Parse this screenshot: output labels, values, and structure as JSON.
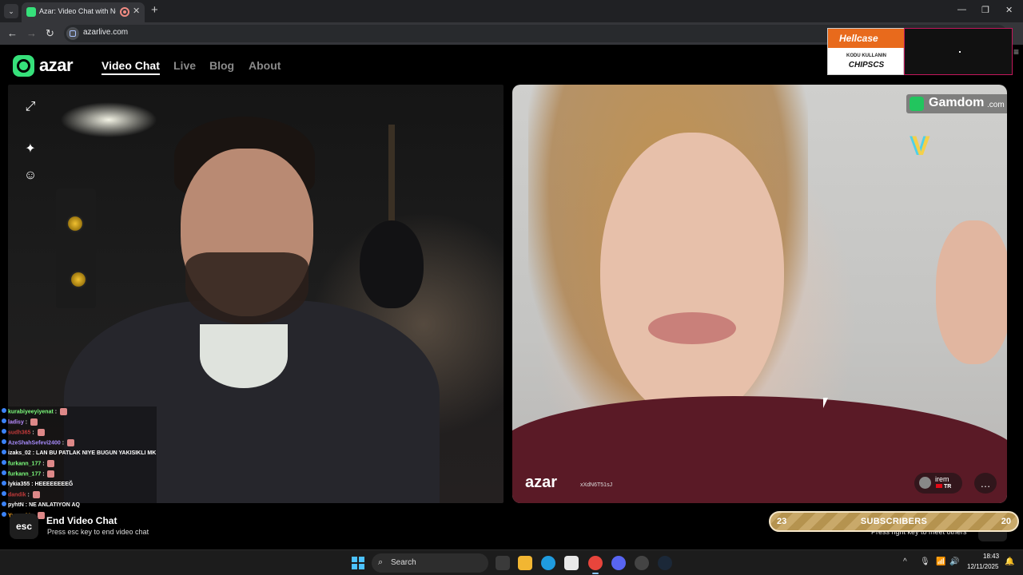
{
  "browser": {
    "tab_title": "Azar: Video Chat with New",
    "tab_close": "✕",
    "new_tab": "+",
    "tab_list": "⌄",
    "url": "azarlive.com",
    "back": "←",
    "forward": "→",
    "reload": "↻",
    "minimize": "—",
    "maximize": "❐",
    "close": "✕"
  },
  "site": {
    "logo": "azar",
    "nav": [
      "Video Chat",
      "Live",
      "Blog",
      "About"
    ],
    "menu": "≡"
  },
  "left_video": {
    "icons": [
      "expand-icon",
      "sparkle-icon",
      "face-icon"
    ],
    "icon_glyphs": [
      "⤢",
      "✦",
      "☺"
    ]
  },
  "right_video": {
    "gamdom": "Gamdom",
    "gamdom_tld": ".com",
    "v_logo": "V",
    "watermark": "azar",
    "watermark_id": "xXdN6T51sJ",
    "user_name": "irem",
    "user_country": "TR",
    "chat_glyph": "…"
  },
  "ad": {
    "brand": "Hellcase",
    "line1": "KODU KULLANIN",
    "line2": "CHIPSCS"
  },
  "chat": [
    {
      "user": "kurabiyeeyiyenat",
      "msg": "",
      "color": "#7cfc7c"
    },
    {
      "user": "ladisy",
      "msg": "",
      "color": "#b88cff"
    },
    {
      "user": "sudh365",
      "msg": "",
      "color": "#c23a3a"
    },
    {
      "user": "AzeShahSefevi2400",
      "msg": "",
      "color": "#a78bfa"
    },
    {
      "user": "izaks_02",
      "msg": "LAN BU PATLAK NIYE BUGUN YAKISIKLI MK",
      "color": "#ffffff"
    },
    {
      "user": "furkann_177",
      "msg": "",
      "color": "#7cfc7c"
    },
    {
      "user": "furkann_177",
      "msg": "",
      "color": "#7cfc7c"
    },
    {
      "user": "lykia355",
      "msg": "HEEEEEEEEĞ",
      "color": "#ffffff"
    },
    {
      "user": "dandik",
      "msg": "",
      "color": "#c23a3a"
    },
    {
      "user": "pyhtN",
      "msg": "NE ANLATIYON AQ",
      "color": "#ffffff"
    },
    {
      "user": "Yunus61",
      "msg": "",
      "color": "#f5a524"
    }
  ],
  "bottom": {
    "esc_key": "esc",
    "end_title": "End Video Chat",
    "end_desc": "Press esc key to end video chat",
    "next_desc": "Press right key to meet others"
  },
  "subscribers": {
    "left": "23",
    "label": "SUBSCRIBERS",
    "right": "20"
  },
  "taskbar": {
    "search_label": "Search",
    "search_glyph": "⌕",
    "time": "18:43",
    "date": "12/11/2025",
    "tray": [
      "^",
      "🎙",
      "📶",
      "🔊",
      "🔔"
    ]
  },
  "colors": {
    "azar_green": "#36e07a",
    "chrome_dark": "#202124",
    "hellcase_orange": "#e86a1c",
    "subs_gold": "#c9a96a"
  }
}
